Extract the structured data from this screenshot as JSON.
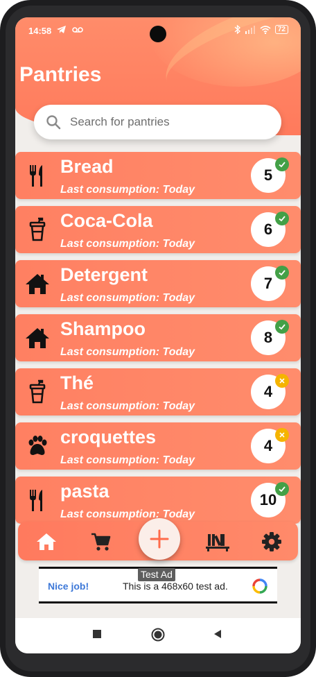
{
  "status_bar": {
    "time": "14:58",
    "left_icons": [
      "telegram-icon",
      "voicemail-icon"
    ],
    "right_icons": [
      "bluetooth-icon",
      "signal-icon",
      "wifi-icon"
    ],
    "battery": "72"
  },
  "header": {
    "title": "Pantries"
  },
  "search": {
    "placeholder": "Search for pantries",
    "value": ""
  },
  "pantries": [
    {
      "name": "Bread",
      "subtitle": "Last consumption: Today",
      "quantity": "5",
      "icon": "utensils-icon",
      "status": "ok"
    },
    {
      "name": "Coca-Cola",
      "subtitle": "Last consumption: Today",
      "quantity": "6",
      "icon": "drink-cup-icon",
      "status": "ok"
    },
    {
      "name": "Detergent",
      "subtitle": "Last consumption: Today",
      "quantity": "7",
      "icon": "home-icon",
      "status": "ok"
    },
    {
      "name": "Shampoo",
      "subtitle": "Last consumption: Today",
      "quantity": "8",
      "icon": "home-icon",
      "status": "ok"
    },
    {
      "name": "Thé",
      "subtitle": "Last consumption: Today",
      "quantity": "4",
      "icon": "drink-cup-icon",
      "status": "low"
    },
    {
      "name": "croquettes",
      "subtitle": "Last consumption: Today",
      "quantity": "4",
      "icon": "paw-icon",
      "status": "low"
    },
    {
      "name": "pasta",
      "subtitle": "Last consumption: Today",
      "quantity": "10",
      "icon": "utensils-icon",
      "status": "ok"
    }
  ],
  "bottom_nav": {
    "items": [
      "home-icon",
      "cart-icon",
      "add-icon",
      "shelves-icon",
      "settings-icon"
    ]
  },
  "tooltip": {
    "text": "Test Ad"
  },
  "ad": {
    "headline": "Nice job!",
    "body": "This is a 468x60 test ad.",
    "logo": "ad-choices-logo"
  },
  "system_nav": {
    "items": [
      "recents-square-icon",
      "home-circle-icon",
      "back-triangle-icon"
    ]
  },
  "colors": {
    "accent": "#ff7f5f",
    "ok_badge": "#43a047",
    "low_badge": "#f5b400",
    "background": "#f1eeeb"
  }
}
